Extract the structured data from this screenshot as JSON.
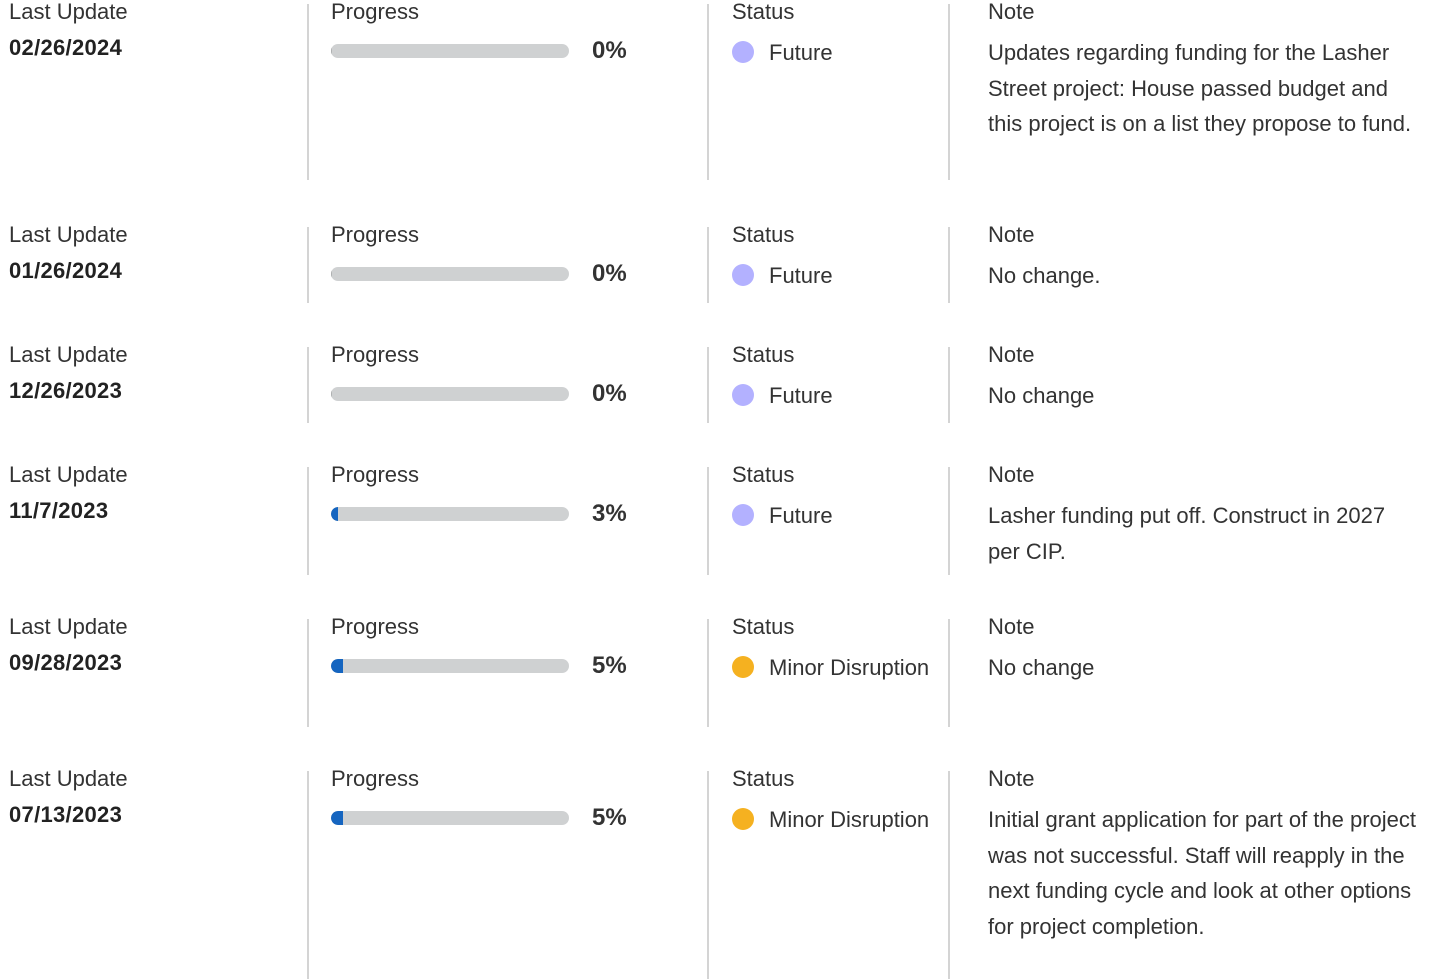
{
  "labels": {
    "last_update": "Last Update",
    "progress": "Progress",
    "status": "Status",
    "note": "Note"
  },
  "colors": {
    "future": "#b3b1ff",
    "minor_disruption": "#f5b120",
    "progress_fill": "#1565c0",
    "progress_track": "#cfd1d2"
  },
  "updates": [
    {
      "date": "02/26/2024",
      "progress_value": 0,
      "progress_label": "0%",
      "status": "Future",
      "status_key": "future",
      "note": "Updates regarding funding for the Lasher Street project: House passed budget and this project is on a list they propose to fund."
    },
    {
      "date": "01/26/2024",
      "progress_value": 0,
      "progress_label": "0%",
      "status": "Future",
      "status_key": "future",
      "note": "No change."
    },
    {
      "date": "12/26/2023",
      "progress_value": 0,
      "progress_label": "0%",
      "status": "Future",
      "status_key": "future",
      "note": "No change"
    },
    {
      "date": "11/7/2023",
      "progress_value": 3,
      "progress_label": "3%",
      "status": "Future",
      "status_key": "future",
      "note": "Lasher funding put off. Construct in 2027 per CIP."
    },
    {
      "date": "09/28/2023",
      "progress_value": 5,
      "progress_label": "5%",
      "status": "Minor Disruption",
      "status_key": "minor_disruption",
      "note": "No change"
    },
    {
      "date": "07/13/2023",
      "progress_value": 5,
      "progress_label": "5%",
      "status": "Minor Disruption",
      "status_key": "minor_disruption",
      "note": "Initial grant application for part of the project was not successful. Staff will reapply in the next funding cycle and look at other options for project completion."
    }
  ]
}
